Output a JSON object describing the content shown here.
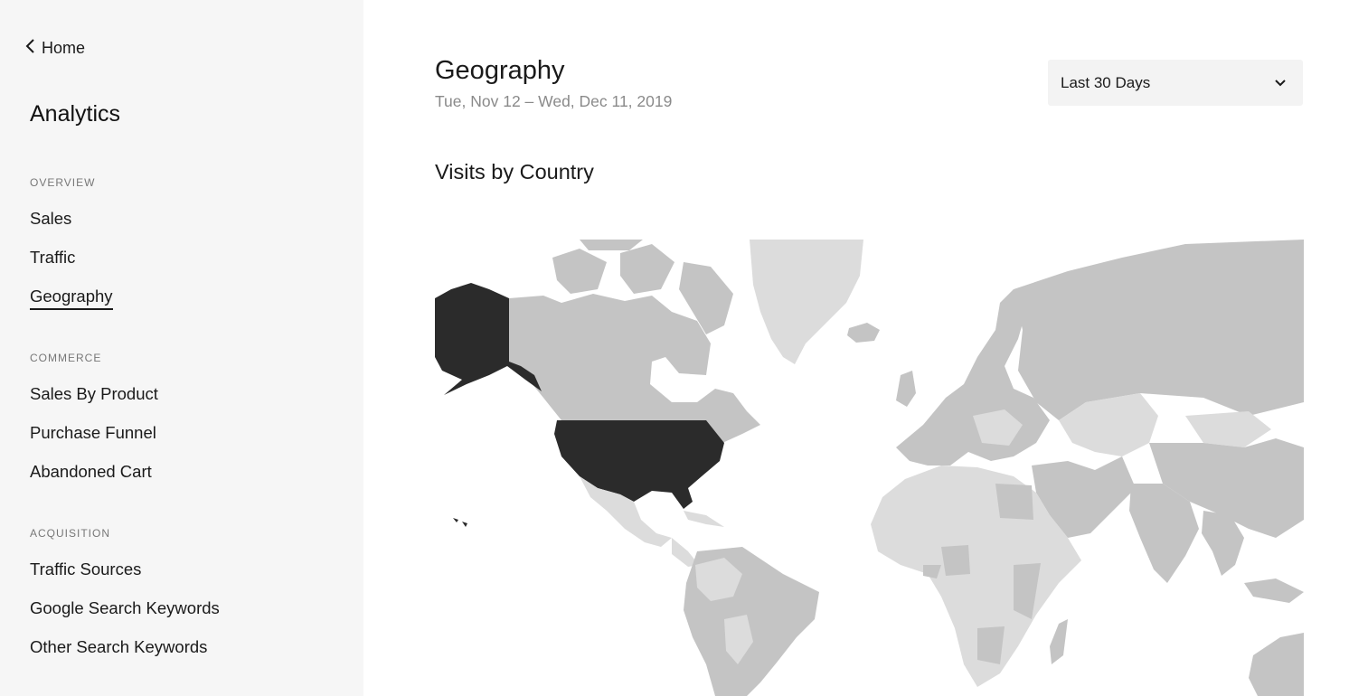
{
  "sidebar": {
    "back_label": "Home",
    "title": "Analytics",
    "sections": [
      {
        "label": "OVERVIEW",
        "items": [
          "Sales",
          "Traffic",
          "Geography"
        ]
      },
      {
        "label": "COMMERCE",
        "items": [
          "Sales By Product",
          "Purchase Funnel",
          "Abandoned Cart"
        ]
      },
      {
        "label": "ACQUISITION",
        "items": [
          "Traffic Sources",
          "Google Search Keywords",
          "Other Search Keywords"
        ]
      }
    ],
    "active_item": "Geography"
  },
  "main": {
    "title": "Geography",
    "date_range": "Tue, Nov 12 – Wed, Dec 11, 2019",
    "range_select": {
      "selected": "Last 30 Days"
    },
    "map_title": "Visits by Country"
  },
  "colors": {
    "sidebar_bg": "#f6f6f6",
    "highlight_country": "#2b2b2b",
    "country_medium": "#c4c4c4",
    "country_light": "#dcdcdc"
  }
}
